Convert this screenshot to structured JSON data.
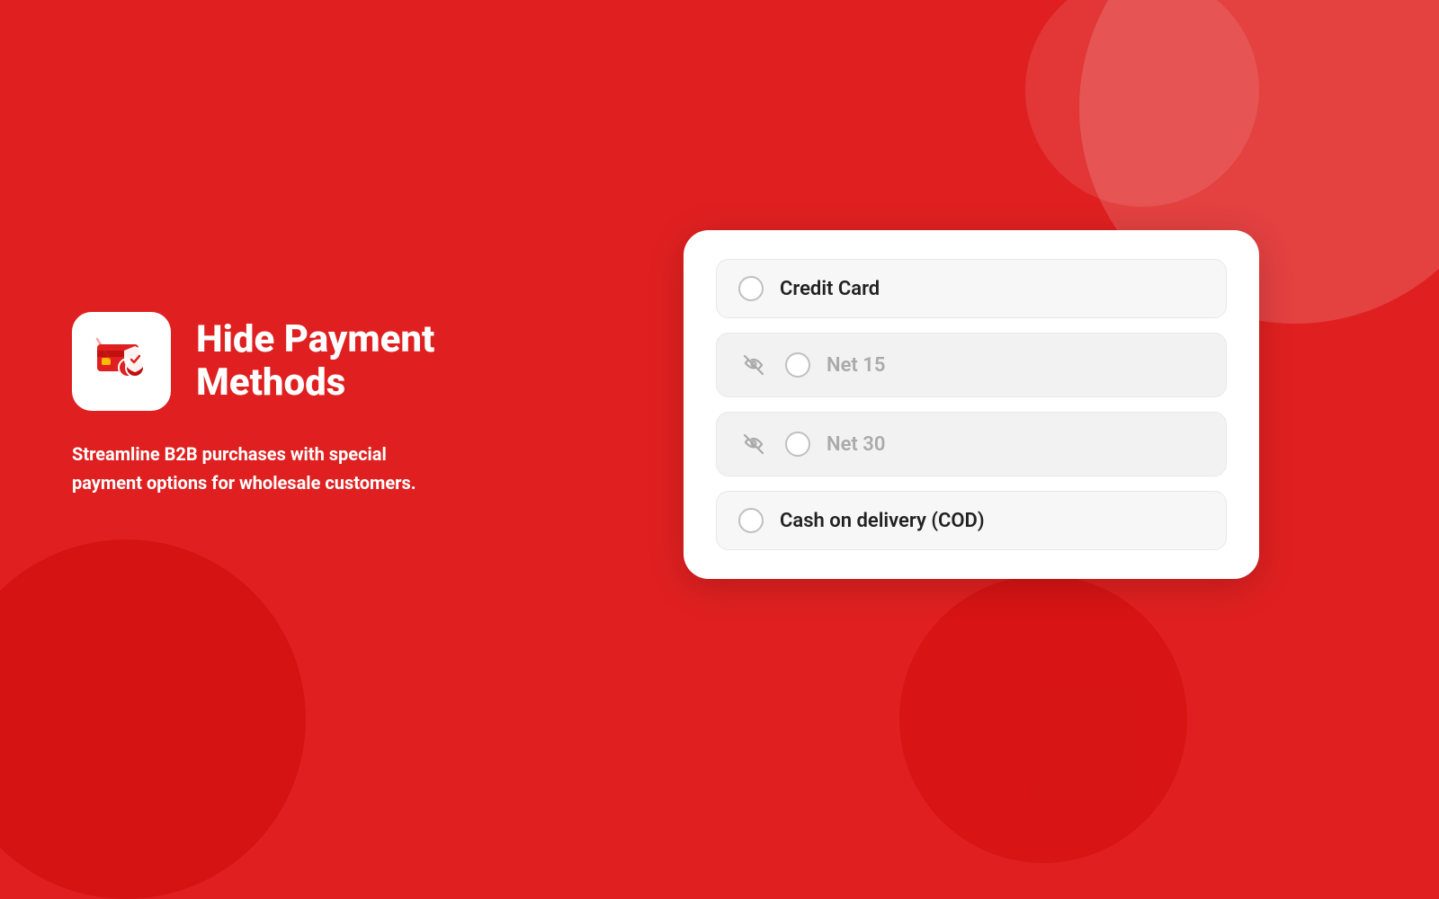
{
  "background": {
    "color": "#e02020"
  },
  "left_panel": {
    "app_title": "Hide Payment Methods",
    "app_description": "Streamline B2B purchases with special payment options for wholesale customers."
  },
  "right_panel": {
    "payment_methods": [
      {
        "id": "credit-card",
        "label": "Credit Card",
        "hidden": false
      },
      {
        "id": "net-15",
        "label": "Net 15",
        "hidden": true
      },
      {
        "id": "net-30",
        "label": "Net 30",
        "hidden": true
      },
      {
        "id": "cod",
        "label": "Cash on delivery (COD)",
        "hidden": false
      }
    ]
  }
}
